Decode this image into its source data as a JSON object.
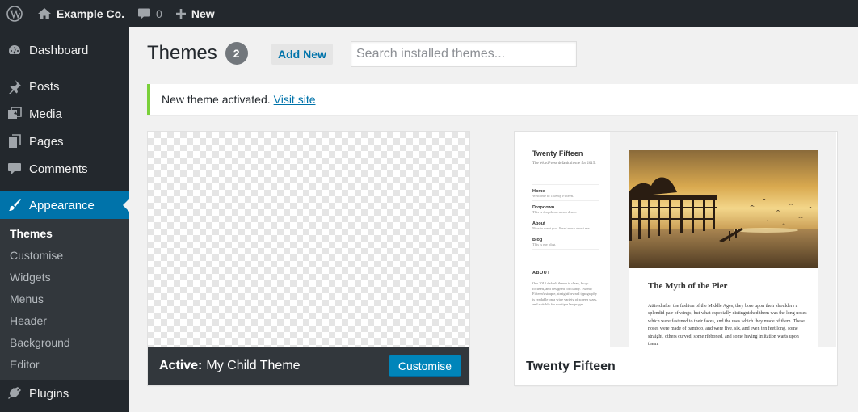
{
  "adminbar": {
    "site_name": "Example Co.",
    "comments_count": "0",
    "new_label": "New"
  },
  "sidebar": {
    "items": [
      {
        "label": "Dashboard",
        "icon": "dashboard-icon"
      },
      {
        "label": "Posts",
        "icon": "pushpin-icon"
      },
      {
        "label": "Media",
        "icon": "media-icon"
      },
      {
        "label": "Pages",
        "icon": "pages-icon"
      },
      {
        "label": "Comments",
        "icon": "comment-icon"
      },
      {
        "label": "Appearance",
        "icon": "paintbrush-icon",
        "current": true
      },
      {
        "label": "Plugins",
        "icon": "plugin-icon"
      }
    ],
    "submenu": [
      "Themes",
      "Customise",
      "Widgets",
      "Menus",
      "Header",
      "Background",
      "Editor"
    ]
  },
  "page": {
    "title": "Themes",
    "count": "2",
    "add_new_label": "Add New",
    "search_placeholder": "Search installed themes..."
  },
  "notice": {
    "text": "New theme activated.",
    "link": "Visit site"
  },
  "themes": [
    {
      "name": "My Child Theme",
      "active_prefix": "Active:",
      "customise_label": "Customise"
    },
    {
      "name": "Twenty Fifteen"
    }
  ],
  "preview": {
    "site_title": "Twenty Fifteen",
    "site_desc": "The WordPress default theme for 2015.",
    "nav": [
      {
        "label": "Home",
        "sub": "Welcome to Twenty Fifteen."
      },
      {
        "label": "Dropdown",
        "sub": "This is dropdown menu demo."
      },
      {
        "label": "About",
        "sub": "Nice to meet you. Read more about me."
      },
      {
        "label": "Blog",
        "sub": "This is my blog."
      }
    ],
    "about_heading": "ABOUT",
    "about_text": "Our 2015 default theme is clean, blog-focused, and designed for clarity. Twenty Fifteen's simple, straightforward typography is readable on a wide variety of screen sizes, and suitable for multiple languages.",
    "post_title": "The Myth of the Pier",
    "post_body": "Attired after the fashion of the Middle Ages, they bore upon their shoulders a splendid pair of wings; but what especially distinguished them was the long noses which were fastened to their faces, and the uses which they made of them. These noses were made of bamboo, and were five, six, and even ten feet long, some straight, others curved, some ribboned, and some having imitation warts upon them."
  },
  "colors": {
    "admin_bg": "#23282d",
    "accent": "#0073aa",
    "button": "#0085ba",
    "notice_border": "#7ad03a"
  }
}
